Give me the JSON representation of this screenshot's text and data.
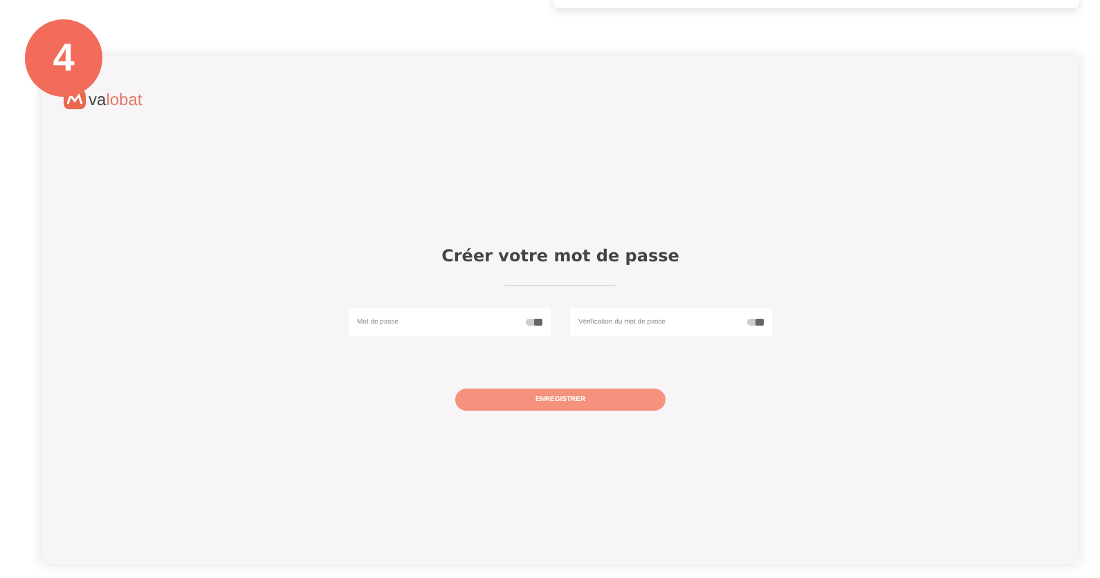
{
  "step_badge": "4",
  "logo": {
    "prefix": "va",
    "suffix": "lobat"
  },
  "form": {
    "title": "Créer votre mot de passe",
    "fields": [
      {
        "placeholder": "Mot de passe"
      },
      {
        "placeholder": "Vérification du mot de passe"
      }
    ],
    "submit": "ENREGISTRER"
  }
}
